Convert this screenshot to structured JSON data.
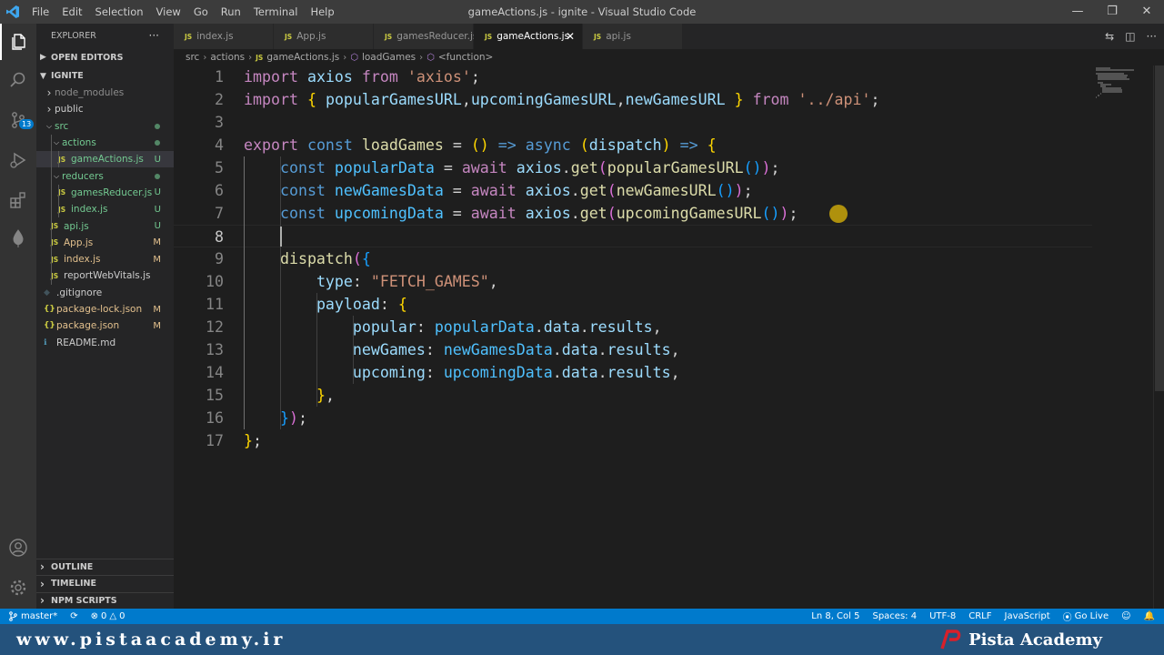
{
  "window": {
    "title": "gameActions.js - ignite - Visual Studio Code",
    "menu": [
      "File",
      "Edit",
      "Selection",
      "View",
      "Go",
      "Run",
      "Terminal",
      "Help"
    ]
  },
  "activity_bar": {
    "items": [
      "explorer-icon",
      "search-icon",
      "source-control-icon",
      "run-debug-icon",
      "extensions-icon",
      "mongodb-icon",
      "accounts-icon",
      "manage-gear-icon"
    ],
    "scm_badge": "13"
  },
  "sidebar": {
    "header": "EXPLORER",
    "more": "···",
    "open_editors": "OPEN EDITORS",
    "project": "IGNITE",
    "tree": [
      {
        "label": "node_modules",
        "type": "folder",
        "depth": 1,
        "expanded": false,
        "status": "",
        "color": "ignored"
      },
      {
        "label": "public",
        "type": "folder",
        "depth": 1,
        "expanded": false,
        "status": "",
        "color": "normal"
      },
      {
        "label": "src",
        "type": "folder",
        "depth": 1,
        "expanded": true,
        "status": "dot",
        "color": "untracked"
      },
      {
        "label": "actions",
        "type": "folder",
        "depth": 2,
        "expanded": true,
        "status": "dot",
        "color": "untracked"
      },
      {
        "label": "gameActions.js",
        "type": "js",
        "depth": 3,
        "status": "U",
        "color": "untracked",
        "selected": true
      },
      {
        "label": "reducers",
        "type": "folder",
        "depth": 2,
        "expanded": true,
        "status": "dot",
        "color": "untracked"
      },
      {
        "label": "gamesReducer.js",
        "type": "js",
        "depth": 3,
        "status": "U",
        "color": "untracked"
      },
      {
        "label": "index.js",
        "type": "js",
        "depth": 3,
        "status": "U",
        "color": "untracked"
      },
      {
        "label": "api.js",
        "type": "js",
        "depth": 2,
        "status": "U",
        "color": "untracked"
      },
      {
        "label": "App.js",
        "type": "js",
        "depth": 2,
        "status": "M",
        "color": "modified"
      },
      {
        "label": "index.js",
        "type": "js",
        "depth": 2,
        "status": "M",
        "color": "modified"
      },
      {
        "label": "reportWebVitals.js",
        "type": "js",
        "depth": 2,
        "status": "",
        "color": "normal"
      },
      {
        "label": ".gitignore",
        "type": "git",
        "depth": 1,
        "status": "",
        "color": "normal"
      },
      {
        "label": "package-lock.json",
        "type": "json",
        "depth": 1,
        "status": "M",
        "color": "modified"
      },
      {
        "label": "package.json",
        "type": "json",
        "depth": 1,
        "status": "M",
        "color": "modified"
      },
      {
        "label": "README.md",
        "type": "md",
        "depth": 1,
        "status": "",
        "color": "normal"
      }
    ],
    "bottom_sections": [
      "OUTLINE",
      "TIMELINE",
      "NPM SCRIPTS"
    ]
  },
  "tabs": [
    {
      "label": "index.js",
      "active": false
    },
    {
      "label": "App.js",
      "active": false
    },
    {
      "label": "gamesReducer.js",
      "active": false
    },
    {
      "label": "gameActions.js",
      "active": true
    },
    {
      "label": "api.js",
      "active": false
    }
  ],
  "breadcrumb": [
    "src",
    "actions",
    "gameActions.js",
    "loadGames",
    "<function>"
  ],
  "editor": {
    "current_line": 8,
    "lines": [
      {
        "n": "1",
        "tokens": [
          [
            "kw",
            "import"
          ],
          [
            "pun",
            " "
          ],
          [
            "var",
            "axios"
          ],
          [
            "pun",
            " "
          ],
          [
            "kw",
            "from"
          ],
          [
            "pun",
            " "
          ],
          [
            "str",
            "'axios'"
          ],
          [
            "pun",
            ";"
          ]
        ]
      },
      {
        "n": "2",
        "tokens": [
          [
            "kw",
            "import"
          ],
          [
            "pun",
            " "
          ],
          [
            "b1",
            "{"
          ],
          [
            "pun",
            " "
          ],
          [
            "var",
            "popularGamesURL"
          ],
          [
            "pun",
            ","
          ],
          [
            "var",
            "upcomingGamesURL"
          ],
          [
            "pun",
            ","
          ],
          [
            "var",
            "newGamesURL"
          ],
          [
            "pun",
            " "
          ],
          [
            "b1",
            "}"
          ],
          [
            "pun",
            " "
          ],
          [
            "kw",
            "from"
          ],
          [
            "pun",
            " "
          ],
          [
            "str",
            "'../api'"
          ],
          [
            "pun",
            ";"
          ]
        ]
      },
      {
        "n": "3",
        "tokens": []
      },
      {
        "n": "4",
        "tokens": [
          [
            "kw",
            "export"
          ],
          [
            "pun",
            " "
          ],
          [
            "st",
            "const"
          ],
          [
            "pun",
            " "
          ],
          [
            "fn",
            "loadGames"
          ],
          [
            "pun",
            " = "
          ],
          [
            "b1",
            "()"
          ],
          [
            "pun",
            " "
          ],
          [
            "st",
            "=>"
          ],
          [
            "pun",
            " "
          ],
          [
            "st",
            "async"
          ],
          [
            "pun",
            " "
          ],
          [
            "b1",
            "("
          ],
          [
            "var",
            "dispatch"
          ],
          [
            "b1",
            ")"
          ],
          [
            "pun",
            " "
          ],
          [
            "st",
            "=>"
          ],
          [
            "pun",
            " "
          ],
          [
            "b1",
            "{"
          ]
        ]
      },
      {
        "n": "5",
        "tokens": [
          [
            "pun",
            "    "
          ],
          [
            "st",
            "const"
          ],
          [
            "pun",
            " "
          ],
          [
            "cn",
            "popularData"
          ],
          [
            "pun",
            " = "
          ],
          [
            "kw",
            "await"
          ],
          [
            "pun",
            " "
          ],
          [
            "var",
            "axios"
          ],
          [
            "pun",
            "."
          ],
          [
            "fn",
            "get"
          ],
          [
            "b2",
            "("
          ],
          [
            "fn",
            "popularGamesURL"
          ],
          [
            "b3",
            "()"
          ],
          [
            "b2",
            ")"
          ],
          [
            "pun",
            ";"
          ]
        ]
      },
      {
        "n": "6",
        "tokens": [
          [
            "pun",
            "    "
          ],
          [
            "st",
            "const"
          ],
          [
            "pun",
            " "
          ],
          [
            "cn",
            "newGamesData"
          ],
          [
            "pun",
            " = "
          ],
          [
            "kw",
            "await"
          ],
          [
            "pun",
            " "
          ],
          [
            "var",
            "axios"
          ],
          [
            "pun",
            "."
          ],
          [
            "fn",
            "get"
          ],
          [
            "b2",
            "("
          ],
          [
            "fn",
            "newGamesURL"
          ],
          [
            "b3",
            "()"
          ],
          [
            "b2",
            ")"
          ],
          [
            "pun",
            ";"
          ]
        ]
      },
      {
        "n": "7",
        "tokens": [
          [
            "pun",
            "    "
          ],
          [
            "st",
            "const"
          ],
          [
            "pun",
            " "
          ],
          [
            "cn",
            "upcomingData"
          ],
          [
            "pun",
            " = "
          ],
          [
            "kw",
            "await"
          ],
          [
            "pun",
            " "
          ],
          [
            "var",
            "axios"
          ],
          [
            "pun",
            "."
          ],
          [
            "fn",
            "get"
          ],
          [
            "b2",
            "("
          ],
          [
            "fn",
            "upcomingGamesURL"
          ],
          [
            "b3",
            "()"
          ],
          [
            "b2",
            ")"
          ],
          [
            "pun",
            ";"
          ]
        ]
      },
      {
        "n": "8",
        "tokens": []
      },
      {
        "n": "9",
        "tokens": [
          [
            "pun",
            "    "
          ],
          [
            "fn",
            "dispatch"
          ],
          [
            "b2",
            "("
          ],
          [
            "b3",
            "{"
          ]
        ]
      },
      {
        "n": "10",
        "tokens": [
          [
            "pun",
            "        "
          ],
          [
            "var",
            "type"
          ],
          [
            "pun",
            ": "
          ],
          [
            "str",
            "\"FETCH_GAMES\""
          ],
          [
            "pun",
            ","
          ]
        ]
      },
      {
        "n": "11",
        "tokens": [
          [
            "pun",
            "        "
          ],
          [
            "var",
            "payload"
          ],
          [
            "pun",
            ": "
          ],
          [
            "b1",
            "{"
          ]
        ]
      },
      {
        "n": "12",
        "tokens": [
          [
            "pun",
            "            "
          ],
          [
            "var",
            "popular"
          ],
          [
            "pun",
            ": "
          ],
          [
            "cn",
            "popularData"
          ],
          [
            "pun",
            "."
          ],
          [
            "var",
            "data"
          ],
          [
            "pun",
            "."
          ],
          [
            "var",
            "results"
          ],
          [
            "pun",
            ","
          ]
        ]
      },
      {
        "n": "13",
        "tokens": [
          [
            "pun",
            "            "
          ],
          [
            "var",
            "newGames"
          ],
          [
            "pun",
            ": "
          ],
          [
            "cn",
            "newGamesData"
          ],
          [
            "pun",
            "."
          ],
          [
            "var",
            "data"
          ],
          [
            "pun",
            "."
          ],
          [
            "var",
            "results"
          ],
          [
            "pun",
            ","
          ]
        ]
      },
      {
        "n": "14",
        "tokens": [
          [
            "pun",
            "            "
          ],
          [
            "var",
            "upcoming"
          ],
          [
            "pun",
            ": "
          ],
          [
            "cn",
            "upcomingData"
          ],
          [
            "pun",
            "."
          ],
          [
            "var",
            "data"
          ],
          [
            "pun",
            "."
          ],
          [
            "var",
            "results"
          ],
          [
            "pun",
            ","
          ]
        ]
      },
      {
        "n": "15",
        "tokens": [
          [
            "pun",
            "        "
          ],
          [
            "b1",
            "}"
          ],
          [
            "pun",
            ","
          ]
        ]
      },
      {
        "n": "16",
        "tokens": [
          [
            "pun",
            "    "
          ],
          [
            "b3",
            "}"
          ],
          [
            "b2",
            ")"
          ],
          [
            "pun",
            ";"
          ]
        ]
      },
      {
        "n": "17",
        "tokens": [
          [
            "b1",
            "}"
          ],
          [
            "pun",
            ";"
          ]
        ]
      }
    ]
  },
  "statusbar": {
    "branch": "master*",
    "errors": "0",
    "warnings": "0",
    "position": "Ln 8, Col 5",
    "spaces": "Spaces: 4",
    "encoding": "UTF-8",
    "eol": "CRLF",
    "language": "JavaScript",
    "golive": "Go Live"
  },
  "watermark": {
    "url": "www.pistaacademy.ir",
    "brand": "Pista Academy"
  }
}
